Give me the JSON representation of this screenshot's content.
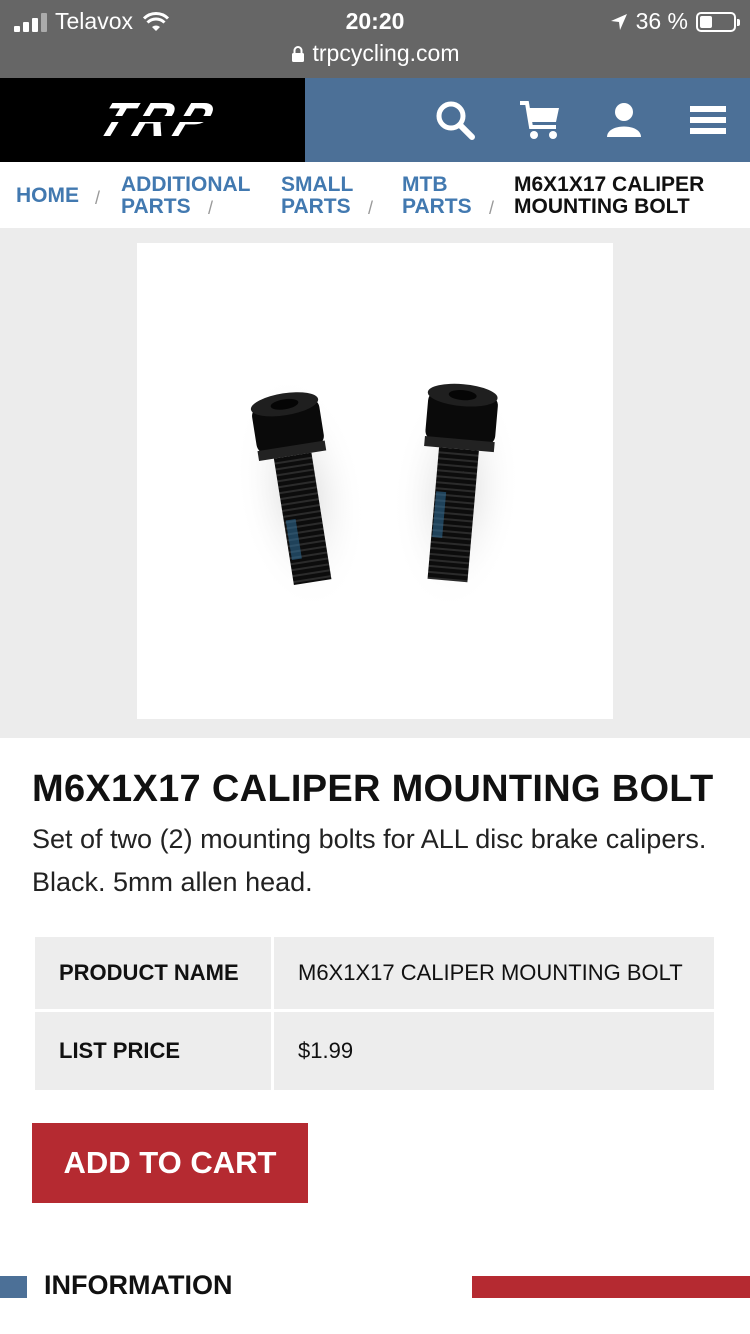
{
  "status_bar": {
    "carrier": "Telavox",
    "time": "20:20",
    "battery_text": "36 %",
    "battery_level": 0.36
  },
  "url_bar": {
    "url": "trpcycling.com"
  },
  "header": {
    "logo_text": "TRP",
    "icons": [
      "search-icon",
      "cart-icon",
      "user-icon",
      "menu-icon"
    ],
    "colors": {
      "logo_bg": "#000000",
      "bar_bg": "#4c7097"
    }
  },
  "breadcrumb": {
    "items": [
      {
        "line1": "HOME",
        "line2": ""
      },
      {
        "line1": "ADDITIONAL",
        "line2": "PARTS"
      },
      {
        "line1": "SMALL",
        "line2": "PARTS"
      },
      {
        "line1": "MTB",
        "line2": "PARTS"
      },
      {
        "line1": "M6X1X17 CALIPER",
        "line2": "MOUNTING BOLT"
      }
    ],
    "separator": "/"
  },
  "product": {
    "title": "M6X1X17 CALIPER MOUNTING BOLT",
    "description": "Set of two (2) mounting bolts for ALL disc brake calipers. Black. 5mm allen head.",
    "specs": [
      {
        "label": "PRODUCT NAME",
        "value": "M6X1X17 CALIPER MOUNTING BOLT"
      },
      {
        "label": "LIST PRICE",
        "value": "$1.99"
      }
    ],
    "add_to_cart_label": "ADD TO CART"
  },
  "sections": {
    "information_title": "INFORMATION"
  },
  "colors": {
    "accent_red": "#b52a31",
    "link_blue": "#4279b0"
  }
}
